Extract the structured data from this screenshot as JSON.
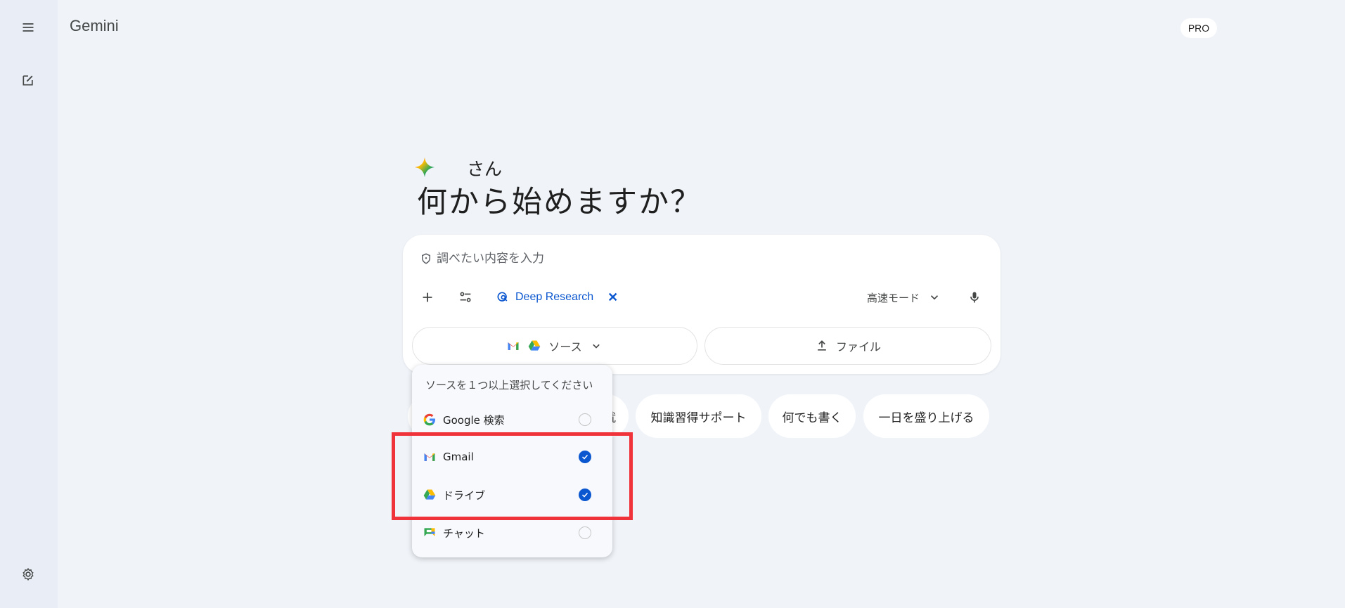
{
  "app": {
    "brand": "Gemini",
    "badge": "PRO"
  },
  "greeting": {
    "name": "さん",
    "title": "何から始めますか？"
  },
  "composer": {
    "placeholder": "調べたい内容を入力",
    "deep_research_label": "Deep Research",
    "mode_label": "高速モード",
    "source_label": "ソース",
    "file_label": "ファイル"
  },
  "suggestions": [
    "就",
    "知識習得サポート",
    "何でも書く",
    "一日を盛り上げる"
  ],
  "dropdown": {
    "header": "ソースを１つ以上選択してください",
    "items": [
      {
        "label": "Google 検索",
        "icon": "google-icon",
        "checked": false
      },
      {
        "label": "Gmail",
        "icon": "gmail-icon",
        "checked": true
      },
      {
        "label": "ドライブ",
        "icon": "drive-icon",
        "checked": true
      },
      {
        "label": "チャット",
        "icon": "chat-icon",
        "checked": false
      }
    ]
  },
  "colors": {
    "accent": "#0b57d0",
    "highlight": "#f0333b",
    "background": "#f0f4f9"
  }
}
